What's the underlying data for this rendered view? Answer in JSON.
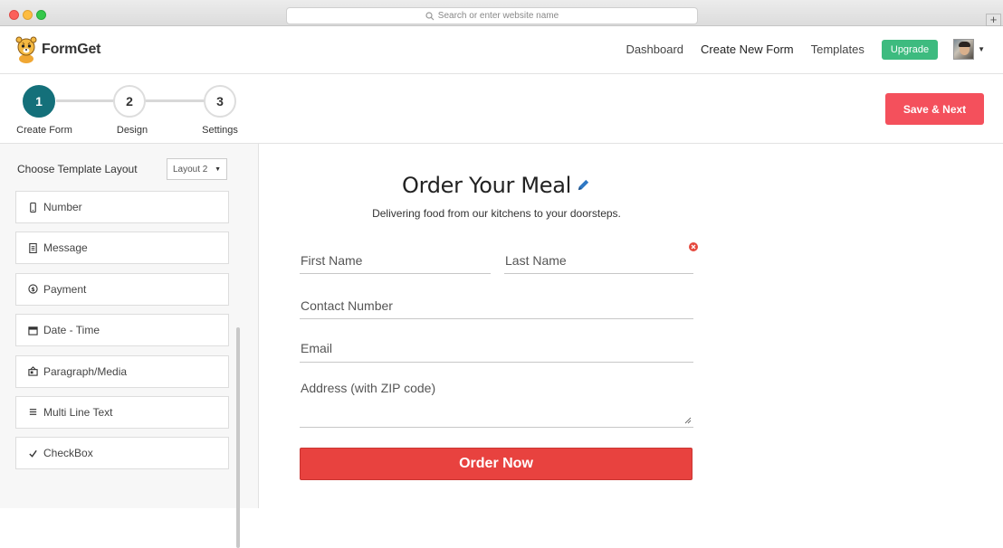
{
  "browser": {
    "url_placeholder": "Search or enter website name"
  },
  "header": {
    "logo_text": "FormGet",
    "nav": {
      "dashboard": "Dashboard",
      "create_new_form": "Create New Form",
      "templates": "Templates",
      "upgrade": "Upgrade"
    }
  },
  "steps": [
    {
      "number": "1",
      "label": "Create Form"
    },
    {
      "number": "2",
      "label": "Design"
    },
    {
      "number": "3",
      "label": "Settings"
    }
  ],
  "sidebar": {
    "layout_label": "Choose Template Layout",
    "layout_value": "Layout 2",
    "fields": [
      {
        "label": "Number",
        "icon": "phone-icon"
      },
      {
        "label": "Message",
        "icon": "document-icon"
      },
      {
        "label": "Payment",
        "icon": "dollar-icon"
      },
      {
        "label": "Date - Time",
        "icon": "calendar-icon"
      },
      {
        "label": "Paragraph/Media",
        "icon": "media-icon"
      },
      {
        "label": "Multi Line Text",
        "icon": "lines-icon"
      },
      {
        "label": "CheckBox",
        "icon": "check-icon"
      }
    ]
  },
  "toolbar": {
    "save_label": "Save & Next"
  },
  "form": {
    "title": "Order Your Meal",
    "subtitle": "Delivering food from our kitchens to your doorsteps.",
    "first_name_placeholder": "First Name",
    "last_name_placeholder": "Last Name",
    "contact_placeholder": "Contact Number",
    "email_placeholder": "Email",
    "address_placeholder": "Address (with ZIP code)",
    "submit_label": "Order Now"
  },
  "colors": {
    "step_active": "#14707a",
    "upgrade": "#3dbb7f",
    "save": "#f4505c",
    "order": "#e8423f"
  }
}
